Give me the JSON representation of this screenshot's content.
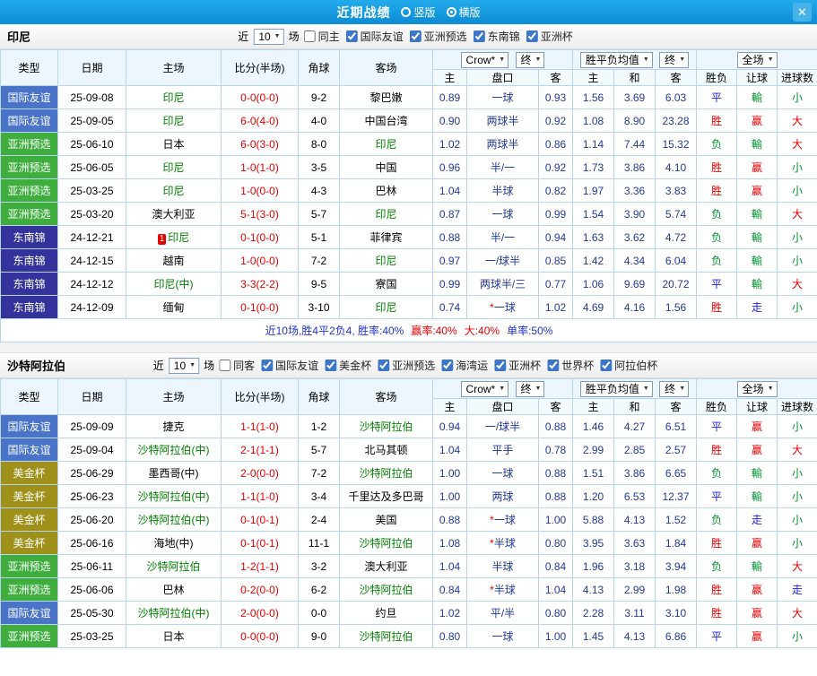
{
  "titlebar": {
    "title": "近期战绩",
    "radio_vertical": "竖版",
    "radio_horizontal": "横版",
    "close": "✕"
  },
  "colors": {
    "types": {
      "国际友谊": "#4A74C8",
      "亚洲预选": "#3FAE3F",
      "东南锦": "#33339B",
      "美金杯": "#9E9019"
    },
    "accent_blue": "#0C8BD3",
    "score_red": "#E60000",
    "team_green": "#008000",
    "odds_navy": "#233A96"
  },
  "table_headers": {
    "col_type": "类型",
    "col_date": "日期",
    "col_home": "主场",
    "col_score": "比分(半场)",
    "col_corner": "角球",
    "col_away": "客场",
    "dd_crow": "Crow*",
    "dd_final": "终",
    "dd_avg": "胜平负均值",
    "dd_full": "全场",
    "sub": [
      "主",
      "盘口",
      "客",
      "主",
      "和",
      "客",
      "胜负",
      "让球",
      "进球数"
    ]
  },
  "sections": [
    {
      "team": "印尼",
      "filter": {
        "near_label": "近",
        "games_value": "10",
        "games_label": "场",
        "items": [
          {
            "label": "同主",
            "checked": false
          },
          {
            "label": "国际友谊",
            "checked": true
          },
          {
            "label": "亚洲预选",
            "checked": true
          },
          {
            "label": "东南锦",
            "checked": true
          },
          {
            "label": "亚洲杯",
            "checked": true
          }
        ]
      },
      "rows": [
        {
          "type": "国际友谊",
          "date": "25-09-08",
          "home": "印尼",
          "home_green": true,
          "score": "0-0(0-0)",
          "corners": "9-2",
          "away": "黎巴嫩",
          "away_green": false,
          "crow_home": "0.89",
          "handicap": "一球",
          "crow_away": "0.93",
          "odds_win": "1.56",
          "odds_draw": "3.69",
          "odds_lose": "6.03",
          "res_wdl": "平",
          "res_handicap": "輸",
          "res_goals": "小"
        },
        {
          "type": "国际友谊",
          "date": "25-09-05",
          "home": "印尼",
          "home_green": true,
          "score": "6-0(4-0)",
          "corners": "4-0",
          "away": "中国台湾",
          "away_green": false,
          "crow_home": "0.90",
          "handicap": "两球半",
          "crow_away": "0.92",
          "odds_win": "1.08",
          "odds_draw": "8.90",
          "odds_lose": "23.28",
          "res_wdl": "胜",
          "res_handicap": "赢",
          "res_goals": "大"
        },
        {
          "type": "亚洲预选",
          "date": "25-06-10",
          "home": "日本",
          "home_green": false,
          "score": "6-0(3-0)",
          "corners": "8-0",
          "away": "印尼",
          "away_green": true,
          "crow_home": "1.02",
          "handicap": "两球半",
          "crow_away": "0.86",
          "odds_win": "1.14",
          "odds_draw": "7.44",
          "odds_lose": "15.32",
          "res_wdl": "负",
          "res_handicap": "輸",
          "res_goals": "大"
        },
        {
          "type": "亚洲预选",
          "date": "25-06-05",
          "home": "印尼",
          "home_green": true,
          "score": "1-0(1-0)",
          "corners": "3-5",
          "away": "中国",
          "away_green": false,
          "crow_home": "0.96",
          "handicap": "半/一",
          "crow_away": "0.92",
          "odds_win": "1.73",
          "odds_draw": "3.86",
          "odds_lose": "4.10",
          "res_wdl": "胜",
          "res_handicap": "赢",
          "res_goals": "小"
        },
        {
          "type": "亚洲预选",
          "date": "25-03-25",
          "home": "印尼",
          "home_green": true,
          "score": "1-0(0-0)",
          "corners": "4-3",
          "away": "巴林",
          "away_green": false,
          "crow_home": "1.04",
          "handicap": "半球",
          "crow_away": "0.82",
          "odds_win": "1.97",
          "odds_draw": "3.36",
          "odds_lose": "3.83",
          "res_wdl": "胜",
          "res_handicap": "赢",
          "res_goals": "小"
        },
        {
          "type": "亚洲预选",
          "date": "25-03-20",
          "home": "澳大利亚",
          "home_green": false,
          "score": "5-1(3-0)",
          "corners": "5-7",
          "away": "印尼",
          "away_green": true,
          "crow_home": "0.87",
          "handicap": "一球",
          "crow_away": "0.99",
          "odds_win": "1.54",
          "odds_draw": "3.90",
          "odds_lose": "5.74",
          "res_wdl": "负",
          "res_handicap": "輸",
          "res_goals": "大"
        },
        {
          "type": "东南锦",
          "date": "24-12-21",
          "home": "印尼",
          "home_green": true,
          "badge": "1",
          "score": "0-1(0-0)",
          "corners": "5-1",
          "away": "菲律宾",
          "away_green": false,
          "crow_home": "0.88",
          "handicap": "半/一",
          "crow_away": "0.94",
          "odds_win": "1.63",
          "odds_draw": "3.62",
          "odds_lose": "4.72",
          "res_wdl": "负",
          "res_handicap": "輸",
          "res_goals": "小"
        },
        {
          "type": "东南锦",
          "date": "24-12-15",
          "home": "越南",
          "home_green": false,
          "score": "1-0(0-0)",
          "corners": "7-2",
          "away": "印尼",
          "away_green": true,
          "crow_home": "0.97",
          "handicap": "一/球半",
          "crow_away": "0.85",
          "odds_win": "1.42",
          "odds_draw": "4.34",
          "odds_lose": "6.04",
          "res_wdl": "负",
          "res_handicap": "輸",
          "res_goals": "小"
        },
        {
          "type": "东南锦",
          "date": "24-12-12",
          "home": "印尼(中)",
          "home_green": true,
          "score": "3-3(2-2)",
          "corners": "9-5",
          "away": "寮国",
          "away_green": false,
          "crow_home": "0.99",
          "handicap": "两球半/三",
          "crow_away": "0.77",
          "odds_win": "1.06",
          "odds_draw": "9.69",
          "odds_lose": "20.72",
          "res_wdl": "平",
          "res_handicap": "輸",
          "res_goals": "大"
        },
        {
          "type": "东南锦",
          "date": "24-12-09",
          "home": "缅甸",
          "home_green": false,
          "score": "0-1(0-0)",
          "corners": "3-10",
          "away": "印尼",
          "away_green": true,
          "crow_home": "0.74",
          "handicap": "*一球",
          "crow_away": "1.02",
          "odds_win": "4.69",
          "odds_draw": "4.16",
          "odds_lose": "1.56",
          "res_wdl": "胜",
          "res_handicap": "走",
          "res_goals": "小"
        }
      ],
      "summary": [
        {
          "text": "近10场,胜4平2负4, 胜率:40%",
          "cls": "sum-blue"
        },
        {
          "text": "赢率:40%",
          "cls": "sum-red"
        },
        {
          "text": "大:40%",
          "cls": "sum-red"
        },
        {
          "text": "单率:50%",
          "cls": "sum-blue"
        }
      ]
    },
    {
      "team": "沙特阿拉伯",
      "filter": {
        "near_label": "近",
        "games_value": "10",
        "games_label": "场",
        "items": [
          {
            "label": "同客",
            "checked": false
          },
          {
            "label": "国际友谊",
            "checked": true
          },
          {
            "label": "美金杯",
            "checked": true
          },
          {
            "label": "亚洲预选",
            "checked": true
          },
          {
            "label": "海湾运",
            "checked": true
          },
          {
            "label": "亚洲杯",
            "checked": true
          },
          {
            "label": "世界杯",
            "checked": true
          },
          {
            "label": "阿拉伯杯",
            "checked": true
          }
        ]
      },
      "rows": [
        {
          "type": "国际友谊",
          "date": "25-09-09",
          "home": "捷克",
          "home_green": false,
          "score": "1-1(1-0)",
          "corners": "1-2",
          "away": "沙特阿拉伯",
          "away_green": true,
          "crow_home": "0.94",
          "handicap": "一/球半",
          "crow_away": "0.88",
          "odds_win": "1.46",
          "odds_draw": "4.27",
          "odds_lose": "6.51",
          "res_wdl": "平",
          "res_handicap": "赢",
          "res_goals": "小"
        },
        {
          "type": "国际友谊",
          "date": "25-09-04",
          "home": "沙特阿拉伯(中)",
          "home_green": true,
          "score": "2-1(1-1)",
          "corners": "5-7",
          "away": "北马其顿",
          "away_green": false,
          "crow_home": "1.04",
          "handicap": "平手",
          "crow_away": "0.78",
          "odds_win": "2.99",
          "odds_draw": "2.85",
          "odds_lose": "2.57",
          "res_wdl": "胜",
          "res_handicap": "赢",
          "res_goals": "大"
        },
        {
          "type": "美金杯",
          "date": "25-06-29",
          "home": "墨西哥(中)",
          "home_green": false,
          "score": "2-0(0-0)",
          "corners": "7-2",
          "away": "沙特阿拉伯",
          "away_green": true,
          "crow_home": "1.00",
          "handicap": "一球",
          "crow_away": "0.88",
          "odds_win": "1.51",
          "odds_draw": "3.86",
          "odds_lose": "6.65",
          "res_wdl": "负",
          "res_handicap": "輸",
          "res_goals": "小"
        },
        {
          "type": "美金杯",
          "date": "25-06-23",
          "home": "沙特阿拉伯(中)",
          "home_green": true,
          "score": "1-1(1-0)",
          "corners": "3-4",
          "away": "千里达及多巴哥",
          "away_green": false,
          "crow_home": "1.00",
          "handicap": "两球",
          "crow_away": "0.88",
          "odds_win": "1.20",
          "odds_draw": "6.53",
          "odds_lose": "12.37",
          "res_wdl": "平",
          "res_handicap": "輸",
          "res_goals": "小"
        },
        {
          "type": "美金杯",
          "date": "25-06-20",
          "home": "沙特阿拉伯(中)",
          "home_green": true,
          "score": "0-1(0-1)",
          "corners": "2-4",
          "away": "美国",
          "away_green": false,
          "crow_home": "0.88",
          "handicap": "*一球",
          "crow_away": "1.00",
          "odds_win": "5.88",
          "odds_draw": "4.13",
          "odds_lose": "1.52",
          "res_wdl": "负",
          "res_handicap": "走",
          "res_goals": "小"
        },
        {
          "type": "美金杯",
          "date": "25-06-16",
          "home": "海地(中)",
          "home_green": false,
          "score": "0-1(0-1)",
          "corners": "11-1",
          "away": "沙特阿拉伯",
          "away_green": true,
          "crow_home": "1.08",
          "handicap": "*半球",
          "crow_away": "0.80",
          "odds_win": "3.95",
          "odds_draw": "3.63",
          "odds_lose": "1.84",
          "res_wdl": "胜",
          "res_handicap": "赢",
          "res_goals": "小"
        },
        {
          "type": "亚洲预选",
          "date": "25-06-11",
          "home": "沙特阿拉伯",
          "home_green": true,
          "score": "1-2(1-1)",
          "corners": "3-2",
          "away": "澳大利亚",
          "away_green": false,
          "crow_home": "1.04",
          "handicap": "半球",
          "crow_away": "0.84",
          "odds_win": "1.96",
          "odds_draw": "3.18",
          "odds_lose": "3.94",
          "res_wdl": "负",
          "res_handicap": "輸",
          "res_goals": "大"
        },
        {
          "type": "亚洲预选",
          "date": "25-06-06",
          "home": "巴林",
          "home_green": false,
          "score": "0-2(0-0)",
          "corners": "6-2",
          "away": "沙特阿拉伯",
          "away_green": true,
          "crow_home": "0.84",
          "handicap": "*半球",
          "crow_away": "1.04",
          "odds_win": "4.13",
          "odds_draw": "2.99",
          "odds_lose": "1.98",
          "res_wdl": "胜",
          "res_handicap": "赢",
          "res_goals": "走"
        },
        {
          "type": "国际友谊",
          "date": "25-05-30",
          "home": "沙特阿拉伯(中)",
          "home_green": true,
          "score": "2-0(0-0)",
          "corners": "0-0",
          "away": "约旦",
          "away_green": false,
          "crow_home": "1.02",
          "handicap": "平/半",
          "crow_away": "0.80",
          "odds_win": "2.28",
          "odds_draw": "3.11",
          "odds_lose": "3.10",
          "res_wdl": "胜",
          "res_handicap": "赢",
          "res_goals": "大"
        },
        {
          "type": "亚洲预选",
          "date": "25-03-25",
          "home": "日本",
          "home_green": false,
          "score": "0-0(0-0)",
          "corners": "9-0",
          "away": "沙特阿拉伯",
          "away_green": true,
          "crow_home": "0.80",
          "handicap": "一球",
          "crow_away": "1.00",
          "odds_win": "1.45",
          "odds_draw": "4.13",
          "odds_lose": "6.86",
          "res_wdl": "平",
          "res_handicap": "赢",
          "res_goals": "小"
        }
      ]
    }
  ]
}
